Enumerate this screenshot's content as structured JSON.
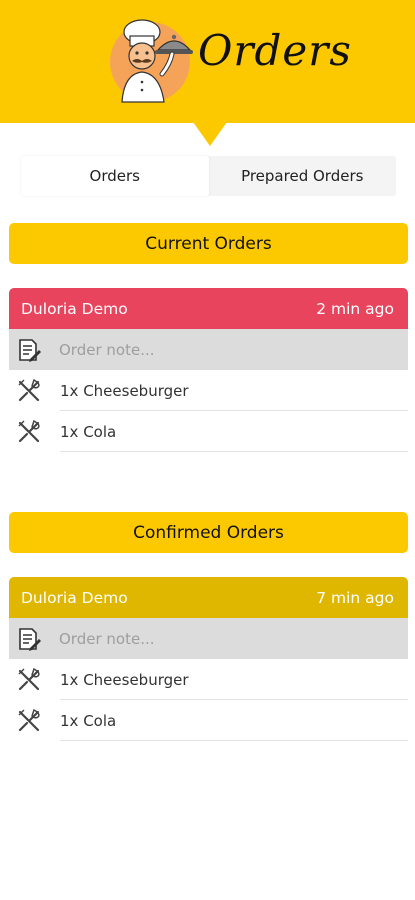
{
  "header": {
    "title": "Orders",
    "logo": "chef-holding-cloche-logo"
  },
  "tabs": [
    {
      "label": "Orders",
      "active": true
    },
    {
      "label": "Prepared Orders",
      "active": false
    }
  ],
  "sections": [
    {
      "title": "Current Orders",
      "order": {
        "customer": "Duloria Demo",
        "time": "2 min ago",
        "header_color": "#e8445e",
        "note_placeholder": "Order note...",
        "items": [
          {
            "label": "1x Cheeseburger"
          },
          {
            "label": "1x Cola"
          }
        ]
      }
    },
    {
      "title": "Confirmed Orders",
      "order": {
        "customer": "Duloria Demo",
        "time": "7 min ago",
        "header_color": "#e0b700",
        "note_placeholder": "Order note...",
        "items": [
          {
            "label": "1x Cheeseburger"
          },
          {
            "label": "1x Cola"
          }
        ]
      }
    }
  ],
  "colors": {
    "brand_yellow": "#fcc900",
    "current_order_header": "#e8445e",
    "confirmed_order_header": "#e0b700",
    "note_bg": "#dcdcdc"
  },
  "icons": {
    "note": "note-pencil-icon",
    "item": "fork-knife-icon"
  }
}
